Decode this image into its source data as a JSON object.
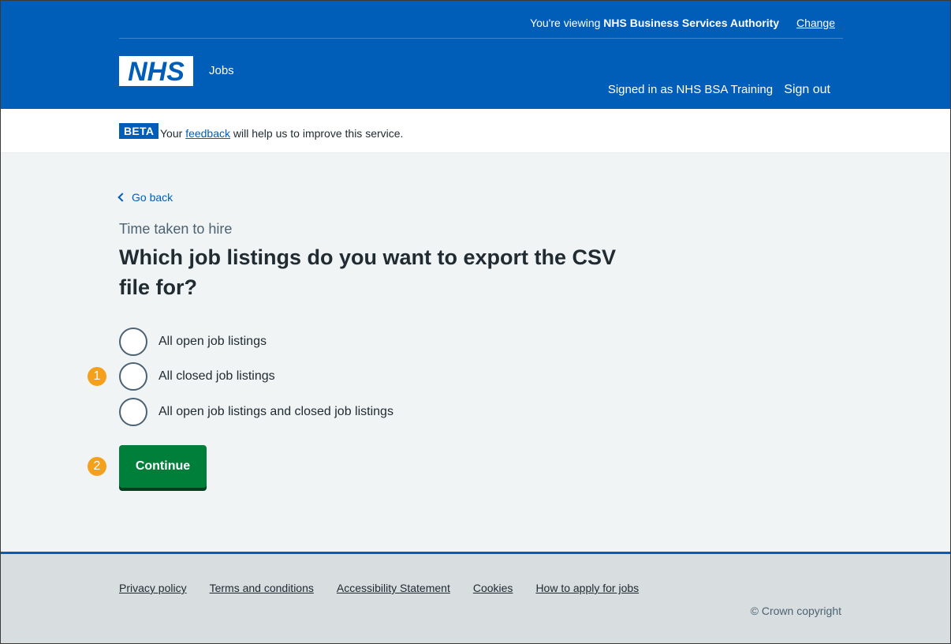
{
  "header": {
    "viewing_prefix": "You're viewing",
    "organisation": "NHS Business Services Authority",
    "change_label": "Change",
    "logo_text": "NHS",
    "service_name": "Jobs",
    "signed_in_text": "Signed in as NHS BSA Training",
    "sign_out_label": "Sign out",
    "brand_color": "#005eb8"
  },
  "beta_banner": {
    "tag": "BETA",
    "text_before": "Your",
    "link": "feedback",
    "text_after": "will help us to improve this service."
  },
  "main": {
    "back_label": "Go back",
    "caption": "Time taken to hire",
    "title": "Which job listings do you want to export the CSV file for?",
    "options": [
      {
        "label": "All open job listings",
        "selected": false
      },
      {
        "label": "All closed job listings",
        "selected": false
      },
      {
        "label": "All open job listings and closed job listings",
        "selected": false
      }
    ],
    "continue_label": "Continue",
    "continue_color": "#007f3b"
  },
  "markers": [
    "1",
    "2"
  ],
  "footer": {
    "links": [
      "Privacy policy",
      "Terms and conditions",
      "Accessibility Statement",
      "Cookies",
      "How to apply for jobs"
    ],
    "copyright": "© Crown copyright"
  }
}
